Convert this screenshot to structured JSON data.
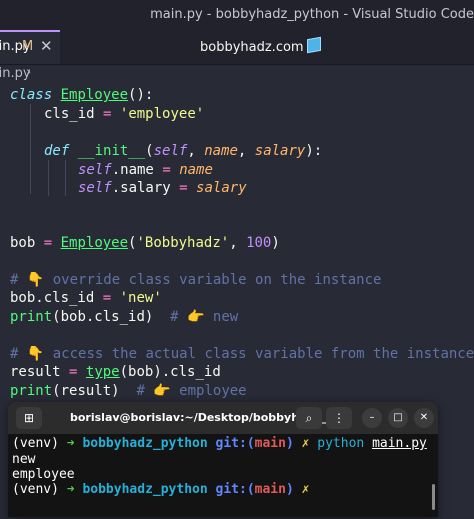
{
  "window": {
    "title": "main.py - bobbyhadz_python - Visual Studio Code"
  },
  "tab": {
    "name": "main.py",
    "modified_badge": "M",
    "close_glyph": "✕"
  },
  "site_title": "bobbyhadz.com",
  "breadcrumb": {
    "text": "main.py",
    "chevron": "›"
  },
  "code": {
    "line1": {
      "kw": "class",
      "name": "Employee",
      "rest": "():"
    },
    "line2": {
      "name": "cls_id",
      "eq": "=",
      "val": "'employee'"
    },
    "line4": {
      "kw": "def",
      "fn": "__init__",
      "open": "(",
      "self": "self",
      "c1": ", ",
      "p1": "name",
      "c2": ", ",
      "p2": "salary",
      "close": "):"
    },
    "line5": {
      "self": "self",
      "attr": ".name",
      "eq": "=",
      "val": "name"
    },
    "line6": {
      "self": "self",
      "attr": ".salary",
      "eq": "=",
      "val": "salary"
    },
    "line9": {
      "var": "bob",
      "eq": "=",
      "cls": "Employee",
      "open": "(",
      "s": "'Bobbyhadz'",
      "comma": ", ",
      "n": "100",
      "close": ")"
    },
    "line11": {
      "hash": "# ",
      "emoji": "👇",
      "text": " override class variable on the instance"
    },
    "line12": {
      "lhs": "bob.cls_id",
      "eq": "=",
      "val": "'new'"
    },
    "line13": {
      "fn": "print",
      "args": "(bob.cls_id)",
      "hash": "  # ",
      "emoji": "👉",
      "text": " new"
    },
    "line15": {
      "hash": "# ",
      "emoji": "👇",
      "text": " access the actual class variable from the instance"
    },
    "line16": {
      "lhs": "result",
      "eq": "=",
      "fn": "type",
      "args": "(bob).cls_id"
    },
    "line17": {
      "fn": "print",
      "args": "(result)",
      "hash": "  # ",
      "emoji": "👉",
      "text": " employee"
    }
  },
  "terminal": {
    "title": "borislav@borislav:~/Desktop/bobbyhadz_...",
    "icons": {
      "new_tab": "new-tab-icon",
      "search": "search-icon",
      "menu": "kebab-menu-icon",
      "minimize": "minimize-icon",
      "maximize": "maximize-icon",
      "close": "close-icon"
    },
    "prompt": {
      "venv": "(venv)",
      "arrow": "➜",
      "dir": "bobbyhadz_python",
      "git": "git:(",
      "branch": "main",
      "git_close": ")",
      "dirty": "✗"
    },
    "cmd": {
      "python": "python",
      "file": "main.py"
    },
    "output": [
      "new",
      "employee"
    ]
  }
}
